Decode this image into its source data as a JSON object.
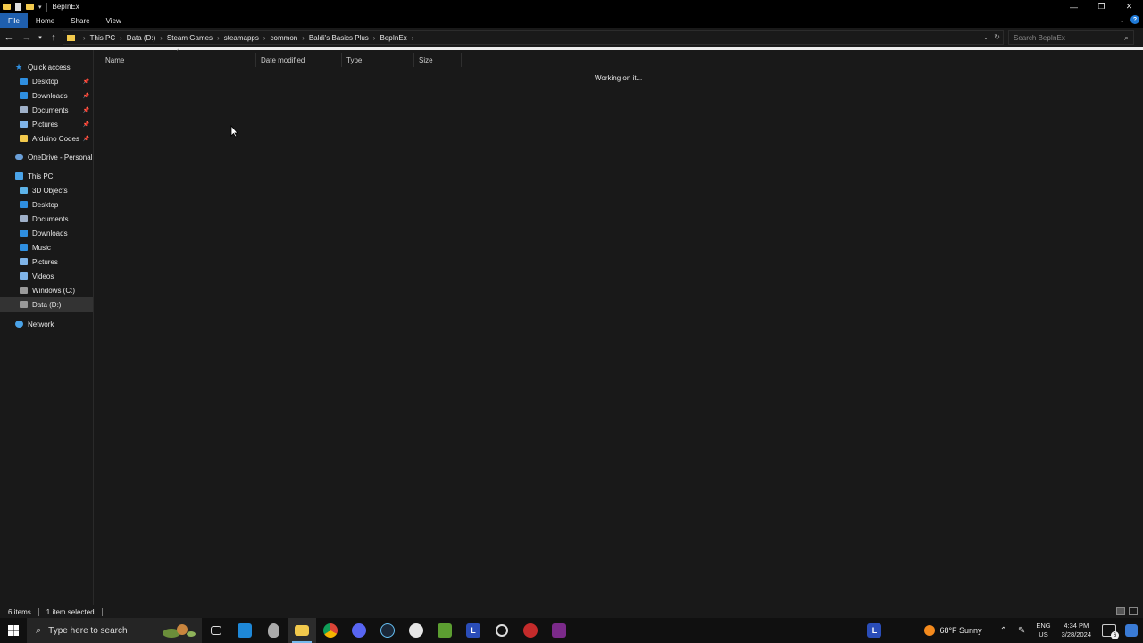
{
  "window": {
    "title": "BepInEx",
    "controls": {
      "minimize": "—",
      "maximize": "❐",
      "close": "✕"
    }
  },
  "ribbon": {
    "tabs": [
      {
        "label": "File",
        "active": true
      },
      {
        "label": "Home"
      },
      {
        "label": "Share"
      },
      {
        "label": "View"
      }
    ]
  },
  "address": {
    "breadcrumbs": [
      "This PC",
      "Data (D:)",
      "Steam Games",
      "steamapps",
      "common",
      "Baldi's Basics Plus",
      "BepInEx"
    ],
    "search_placeholder": "Search BepInEx"
  },
  "nav": {
    "quick_access": "Quick access",
    "quick_items": [
      {
        "label": "Desktop",
        "icon": "desktop-icon",
        "color": "#2f8fe0"
      },
      {
        "label": "Downloads",
        "icon": "downloads-icon",
        "color": "#2f8fe0"
      },
      {
        "label": "Documents",
        "icon": "documents-icon",
        "color": "#9fb0c8"
      },
      {
        "label": "Pictures",
        "icon": "pictures-icon",
        "color": "#7fb4e8"
      },
      {
        "label": "Arduino Codes",
        "icon": "folder-icon",
        "color": "#f2c94c"
      }
    ],
    "onedrive": "OneDrive - Personal",
    "this_pc": "This PC",
    "pc_items": [
      {
        "label": "3D Objects",
        "icon": "3d-objects-icon",
        "color": "#5db3e8"
      },
      {
        "label": "Desktop",
        "icon": "desktop-icon",
        "color": "#2f8fe0"
      },
      {
        "label": "Documents",
        "icon": "documents-icon",
        "color": "#9fb0c8"
      },
      {
        "label": "Downloads",
        "icon": "downloads-icon",
        "color": "#2f8fe0"
      },
      {
        "label": "Music",
        "icon": "music-icon",
        "color": "#2f8fe0"
      },
      {
        "label": "Pictures",
        "icon": "pictures-icon",
        "color": "#7fb4e8"
      },
      {
        "label": "Videos",
        "icon": "videos-icon",
        "color": "#7fb4e8"
      },
      {
        "label": "Windows (C:)",
        "icon": "drive-icon",
        "color": "#9a9a9a"
      },
      {
        "label": "Data (D:)",
        "icon": "drive-icon",
        "color": "#9a9a9a",
        "selected": true
      }
    ],
    "network": "Network"
  },
  "columns": [
    "Name",
    "Date modified",
    "Type",
    "Size"
  ],
  "content": {
    "loading_text": "Working on it..."
  },
  "status": {
    "items": "6 items",
    "selected": "1 item selected"
  },
  "taskbar": {
    "search_placeholder": "Type here to search",
    "weather": "68°F  Sunny",
    "lang_top": "ENG",
    "lang_bottom": "US",
    "time": "4:34 PM",
    "date": "3/28/2024",
    "notification_count": "6"
  }
}
